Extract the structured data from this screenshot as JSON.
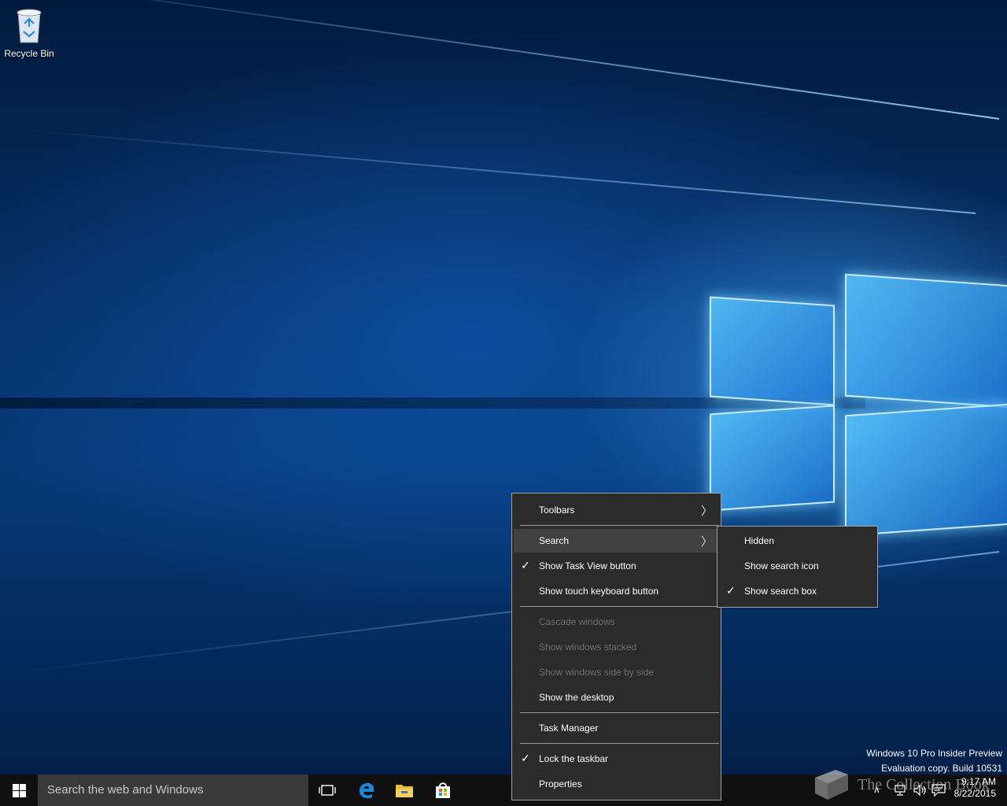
{
  "desktop": {
    "icons": [
      {
        "label": "Recycle Bin",
        "icon": "recycle-bin-icon"
      }
    ],
    "watermark": {
      "line1": "Windows 10 Pro Insider Preview",
      "line2": "Evaluation copy. Build 10531"
    },
    "overlay_text": "The Collection Book"
  },
  "taskbar": {
    "search_placeholder": "Search the web and Windows",
    "pinned": [
      "task-view-icon",
      "edge-icon",
      "file-explorer-icon",
      "store-icon"
    ],
    "clock": {
      "time": "9:17 AM",
      "date": "8/22/2015"
    }
  },
  "context_menu": {
    "items": [
      {
        "label": "Toolbars",
        "has_submenu": true
      },
      {
        "label": "Search",
        "has_submenu": true,
        "highlighted": true
      },
      {
        "label": "Show Task View button",
        "checked": true
      },
      {
        "label": "Show touch keyboard button"
      },
      {
        "label": "Cascade windows",
        "disabled": true
      },
      {
        "label": "Show windows stacked",
        "disabled": true
      },
      {
        "label": "Show windows side by side",
        "disabled": true
      },
      {
        "label": "Show the desktop"
      },
      {
        "label": "Task Manager"
      },
      {
        "label": "Lock the taskbar",
        "checked": true
      },
      {
        "label": "Properties"
      }
    ]
  },
  "search_submenu": {
    "items": [
      {
        "label": "Hidden"
      },
      {
        "label": "Show search icon"
      },
      {
        "label": "Show search box",
        "checked": true
      }
    ]
  },
  "colors": {
    "menu_bg": "#2b2b2b",
    "menu_highlight": "#414141",
    "taskbar_bg": "#101010",
    "search_box_bg": "#3a3a3a",
    "accent": "#0078d7"
  }
}
